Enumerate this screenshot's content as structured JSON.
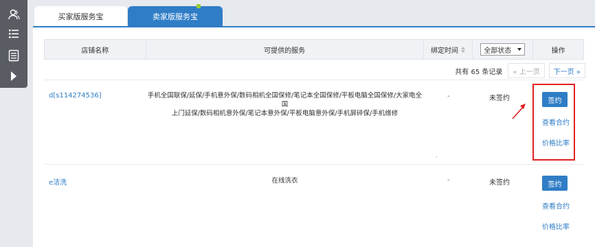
{
  "tabs": [
    {
      "label": "买家版服务宝"
    },
    {
      "label": "卖家版服务宝"
    }
  ],
  "table": {
    "headers": {
      "shop_name": "店铺名称",
      "services": "可提供的服务",
      "bind_time": "绑定时间",
      "status_select": "全部状态",
      "operation": "操作"
    }
  },
  "pager": {
    "total": "共有 65 条记录",
    "prev": "« 上一页",
    "next": "下一页 »"
  },
  "rows": [
    {
      "shop": "d[s114274536]",
      "services_line1": "手机全国联保/延保/手机意外保/数码相机全国保修/笔记本全国保修/平板电脑全国保修/大家电全国",
      "services_line2": "上门延保/数码相机意外保/笔记本意外保/平板电脑意外保/手机屏碎保/手机维修",
      "bind_time": "-",
      "status": "未签约",
      "sign": "签约",
      "view": "查看合约",
      "compare": "价格比率"
    },
    {
      "shop": "e洁洗",
      "services_line1": "在线洗衣",
      "bind_time": "-",
      "status": "未签约",
      "sign": "签约",
      "view": "查看合约",
      "compare": "价格比率"
    }
  ],
  "colors": {
    "accent": "#2f7dc6",
    "highlight": "#e0201f",
    "rail": "#595d63"
  }
}
